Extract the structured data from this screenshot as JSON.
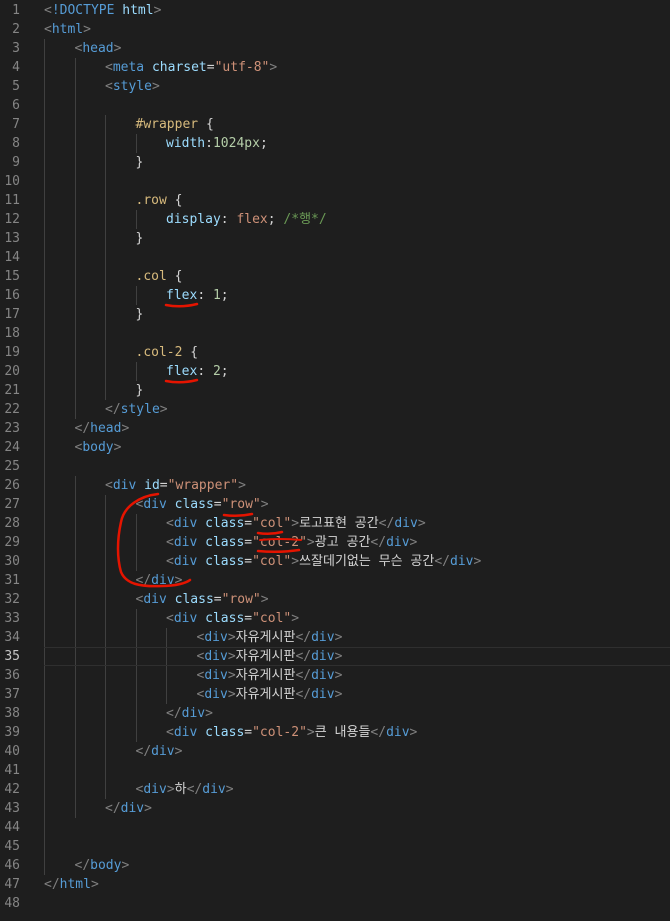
{
  "editor": {
    "active_line": 35,
    "theme_colors": {
      "background": "#1e1e1e",
      "tag": "#569cd6",
      "attribute": "#9cdcfe",
      "string": "#ce9178",
      "selector": "#d7ba7d",
      "number": "#b5cea8",
      "comment": "#6a9955",
      "text": "#d4d4d4",
      "annotation": "#e51400"
    },
    "lines": [
      {
        "n": "1",
        "indent": 0,
        "tokens": [
          [
            "punc",
            "<"
          ],
          [
            "tag",
            "!DOCTYPE"
          ],
          [
            "text",
            " "
          ],
          [
            "attr",
            "html"
          ],
          [
            "punc",
            ">"
          ]
        ]
      },
      {
        "n": "2",
        "indent": 0,
        "tokens": [
          [
            "punc",
            "<"
          ],
          [
            "tag",
            "html"
          ],
          [
            "punc",
            ">"
          ]
        ]
      },
      {
        "n": "3",
        "indent": 1,
        "tokens": [
          [
            "punc",
            "<"
          ],
          [
            "tag",
            "head"
          ],
          [
            "punc",
            ">"
          ]
        ]
      },
      {
        "n": "4",
        "indent": 2,
        "tokens": [
          [
            "punc",
            "<"
          ],
          [
            "tag",
            "meta"
          ],
          [
            "text",
            " "
          ],
          [
            "attr",
            "charset"
          ],
          [
            "text",
            "="
          ],
          [
            "str",
            "\"utf-8\""
          ],
          [
            "punc",
            ">"
          ]
        ]
      },
      {
        "n": "5",
        "indent": 2,
        "tokens": [
          [
            "punc",
            "<"
          ],
          [
            "tag",
            "style"
          ],
          [
            "punc",
            ">"
          ]
        ]
      },
      {
        "n": "6",
        "indent": 0,
        "tokens": []
      },
      {
        "n": "7",
        "indent": 3,
        "tokens": [
          [
            "sel",
            "#wrapper"
          ],
          [
            "text",
            " {"
          ]
        ]
      },
      {
        "n": "8",
        "indent": 4,
        "tokens": [
          [
            "prop",
            "width"
          ],
          [
            "text",
            ":"
          ],
          [
            "num",
            "1024px"
          ],
          [
            "text",
            ";"
          ]
        ]
      },
      {
        "n": "9",
        "indent": 3,
        "tokens": [
          [
            "text",
            "}"
          ]
        ]
      },
      {
        "n": "10",
        "indent": 0,
        "tokens": []
      },
      {
        "n": "11",
        "indent": 3,
        "tokens": [
          [
            "sel",
            ".row"
          ],
          [
            "text",
            " {"
          ]
        ]
      },
      {
        "n": "12",
        "indent": 4,
        "tokens": [
          [
            "prop",
            "display"
          ],
          [
            "text",
            ": "
          ],
          [
            "val",
            "flex"
          ],
          [
            "text",
            "; "
          ],
          [
            "com",
            "/*행*/"
          ]
        ]
      },
      {
        "n": "13",
        "indent": 3,
        "tokens": [
          [
            "text",
            "}"
          ]
        ]
      },
      {
        "n": "14",
        "indent": 0,
        "tokens": []
      },
      {
        "n": "15",
        "indent": 3,
        "tokens": [
          [
            "sel",
            ".col"
          ],
          [
            "text",
            " {"
          ]
        ]
      },
      {
        "n": "16",
        "indent": 4,
        "tokens": [
          [
            "prop",
            "flex"
          ],
          [
            "text",
            ": "
          ],
          [
            "num",
            "1"
          ],
          [
            "text",
            ";"
          ]
        ]
      },
      {
        "n": "17",
        "indent": 3,
        "tokens": [
          [
            "text",
            "}"
          ]
        ]
      },
      {
        "n": "18",
        "indent": 0,
        "tokens": []
      },
      {
        "n": "19",
        "indent": 3,
        "tokens": [
          [
            "sel",
            ".col-2"
          ],
          [
            "text",
            " {"
          ]
        ]
      },
      {
        "n": "20",
        "indent": 4,
        "tokens": [
          [
            "prop",
            "flex"
          ],
          [
            "text",
            ": "
          ],
          [
            "num",
            "2"
          ],
          [
            "text",
            ";"
          ]
        ]
      },
      {
        "n": "21",
        "indent": 3,
        "tokens": [
          [
            "text",
            "}"
          ]
        ]
      },
      {
        "n": "22",
        "indent": 2,
        "tokens": [
          [
            "punc",
            "</"
          ],
          [
            "tag",
            "style"
          ],
          [
            "punc",
            ">"
          ]
        ]
      },
      {
        "n": "23",
        "indent": 1,
        "tokens": [
          [
            "punc",
            "</"
          ],
          [
            "tag",
            "head"
          ],
          [
            "punc",
            ">"
          ]
        ]
      },
      {
        "n": "24",
        "indent": 1,
        "tokens": [
          [
            "punc",
            "<"
          ],
          [
            "tag",
            "body"
          ],
          [
            "punc",
            ">"
          ]
        ]
      },
      {
        "n": "25",
        "indent": 0,
        "tokens": []
      },
      {
        "n": "26",
        "indent": 2,
        "tokens": [
          [
            "punc",
            "<"
          ],
          [
            "tag",
            "div"
          ],
          [
            "text",
            " "
          ],
          [
            "attr",
            "id"
          ],
          [
            "text",
            "="
          ],
          [
            "str",
            "\"wrapper\""
          ],
          [
            "punc",
            ">"
          ]
        ]
      },
      {
        "n": "27",
        "indent": 3,
        "tokens": [
          [
            "punc",
            "<"
          ],
          [
            "tag",
            "div"
          ],
          [
            "text",
            " "
          ],
          [
            "attr",
            "class"
          ],
          [
            "text",
            "="
          ],
          [
            "str",
            "\"row\""
          ],
          [
            "punc",
            ">"
          ]
        ]
      },
      {
        "n": "28",
        "indent": 4,
        "tokens": [
          [
            "punc",
            "<"
          ],
          [
            "tag",
            "div"
          ],
          [
            "text",
            " "
          ],
          [
            "attr",
            "class"
          ],
          [
            "text",
            "="
          ],
          [
            "str",
            "\"col\""
          ],
          [
            "punc",
            ">"
          ],
          [
            "text",
            "로고표현 공간"
          ],
          [
            "punc",
            "</"
          ],
          [
            "tag",
            "div"
          ],
          [
            "punc",
            ">"
          ]
        ]
      },
      {
        "n": "29",
        "indent": 4,
        "tokens": [
          [
            "punc",
            "<"
          ],
          [
            "tag",
            "div"
          ],
          [
            "text",
            " "
          ],
          [
            "attr",
            "class"
          ],
          [
            "text",
            "="
          ],
          [
            "str",
            "\"col-2\""
          ],
          [
            "punc",
            ">"
          ],
          [
            "text",
            "광고 공간"
          ],
          [
            "punc",
            "</"
          ],
          [
            "tag",
            "div"
          ],
          [
            "punc",
            ">"
          ]
        ]
      },
      {
        "n": "30",
        "indent": 4,
        "tokens": [
          [
            "punc",
            "<"
          ],
          [
            "tag",
            "div"
          ],
          [
            "text",
            " "
          ],
          [
            "attr",
            "class"
          ],
          [
            "text",
            "="
          ],
          [
            "str",
            "\"col\""
          ],
          [
            "punc",
            ">"
          ],
          [
            "text",
            "쓰잘데기없는 무슨 공간"
          ],
          [
            "punc",
            "</"
          ],
          [
            "tag",
            "div"
          ],
          [
            "punc",
            ">"
          ]
        ]
      },
      {
        "n": "31",
        "indent": 3,
        "tokens": [
          [
            "punc",
            "</"
          ],
          [
            "tag",
            "div"
          ],
          [
            "punc",
            ">"
          ]
        ]
      },
      {
        "n": "32",
        "indent": 3,
        "tokens": [
          [
            "punc",
            "<"
          ],
          [
            "tag",
            "div"
          ],
          [
            "text",
            " "
          ],
          [
            "attr",
            "class"
          ],
          [
            "text",
            "="
          ],
          [
            "str",
            "\"row\""
          ],
          [
            "punc",
            ">"
          ]
        ]
      },
      {
        "n": "33",
        "indent": 4,
        "tokens": [
          [
            "punc",
            "<"
          ],
          [
            "tag",
            "div"
          ],
          [
            "text",
            " "
          ],
          [
            "attr",
            "class"
          ],
          [
            "text",
            "="
          ],
          [
            "str",
            "\"col\""
          ],
          [
            "punc",
            ">"
          ]
        ]
      },
      {
        "n": "34",
        "indent": 5,
        "tokens": [
          [
            "punc",
            "<"
          ],
          [
            "tag",
            "div"
          ],
          [
            "punc",
            ">"
          ],
          [
            "text",
            "자유게시판"
          ],
          [
            "punc",
            "</"
          ],
          [
            "tag",
            "div"
          ],
          [
            "punc",
            ">"
          ]
        ]
      },
      {
        "n": "35",
        "indent": 5,
        "tokens": [
          [
            "punc",
            "<"
          ],
          [
            "tag",
            "div"
          ],
          [
            "punc",
            ">"
          ],
          [
            "text",
            "자유게시판"
          ],
          [
            "punc",
            "</"
          ],
          [
            "tag",
            "div"
          ],
          [
            "punc",
            ">"
          ]
        ]
      },
      {
        "n": "36",
        "indent": 5,
        "tokens": [
          [
            "punc",
            "<"
          ],
          [
            "tag",
            "div"
          ],
          [
            "punc",
            ">"
          ],
          [
            "text",
            "자유게시판"
          ],
          [
            "punc",
            "</"
          ],
          [
            "tag",
            "div"
          ],
          [
            "punc",
            ">"
          ]
        ]
      },
      {
        "n": "37",
        "indent": 5,
        "tokens": [
          [
            "punc",
            "<"
          ],
          [
            "tag",
            "div"
          ],
          [
            "punc",
            ">"
          ],
          [
            "text",
            "자유게시판"
          ],
          [
            "punc",
            "</"
          ],
          [
            "tag",
            "div"
          ],
          [
            "punc",
            ">"
          ]
        ]
      },
      {
        "n": "38",
        "indent": 4,
        "tokens": [
          [
            "punc",
            "</"
          ],
          [
            "tag",
            "div"
          ],
          [
            "punc",
            ">"
          ]
        ]
      },
      {
        "n": "39",
        "indent": 4,
        "tokens": [
          [
            "punc",
            "<"
          ],
          [
            "tag",
            "div"
          ],
          [
            "text",
            " "
          ],
          [
            "attr",
            "class"
          ],
          [
            "text",
            "="
          ],
          [
            "str",
            "\"col-2\""
          ],
          [
            "punc",
            ">"
          ],
          [
            "text",
            "큰 내용들"
          ],
          [
            "punc",
            "</"
          ],
          [
            "tag",
            "div"
          ],
          [
            "punc",
            ">"
          ]
        ]
      },
      {
        "n": "40",
        "indent": 3,
        "tokens": [
          [
            "punc",
            "</"
          ],
          [
            "tag",
            "div"
          ],
          [
            "punc",
            ">"
          ]
        ]
      },
      {
        "n": "41",
        "indent": 0,
        "tokens": []
      },
      {
        "n": "42",
        "indent": 3,
        "tokens": [
          [
            "punc",
            "<"
          ],
          [
            "tag",
            "div"
          ],
          [
            "punc",
            ">"
          ],
          [
            "text",
            "하"
          ],
          [
            "punc",
            "</"
          ],
          [
            "tag",
            "div"
          ],
          [
            "punc",
            ">"
          ]
        ]
      },
      {
        "n": "43",
        "indent": 2,
        "tokens": [
          [
            "punc",
            "</"
          ],
          [
            "tag",
            "div"
          ],
          [
            "punc",
            ">"
          ]
        ]
      },
      {
        "n": "44",
        "indent": 0,
        "tokens": []
      },
      {
        "n": "45",
        "indent": 0,
        "tokens": []
      },
      {
        "n": "46",
        "indent": 1,
        "tokens": [
          [
            "punc",
            "</"
          ],
          [
            "tag",
            "body"
          ],
          [
            "punc",
            ">"
          ]
        ]
      },
      {
        "n": "47",
        "indent": 0,
        "tokens": [
          [
            "punc",
            "</"
          ],
          [
            "tag",
            "html"
          ],
          [
            "punc",
            ">"
          ]
        ]
      },
      {
        "n": "48",
        "indent": 0,
        "tokens": []
      }
    ]
  }
}
